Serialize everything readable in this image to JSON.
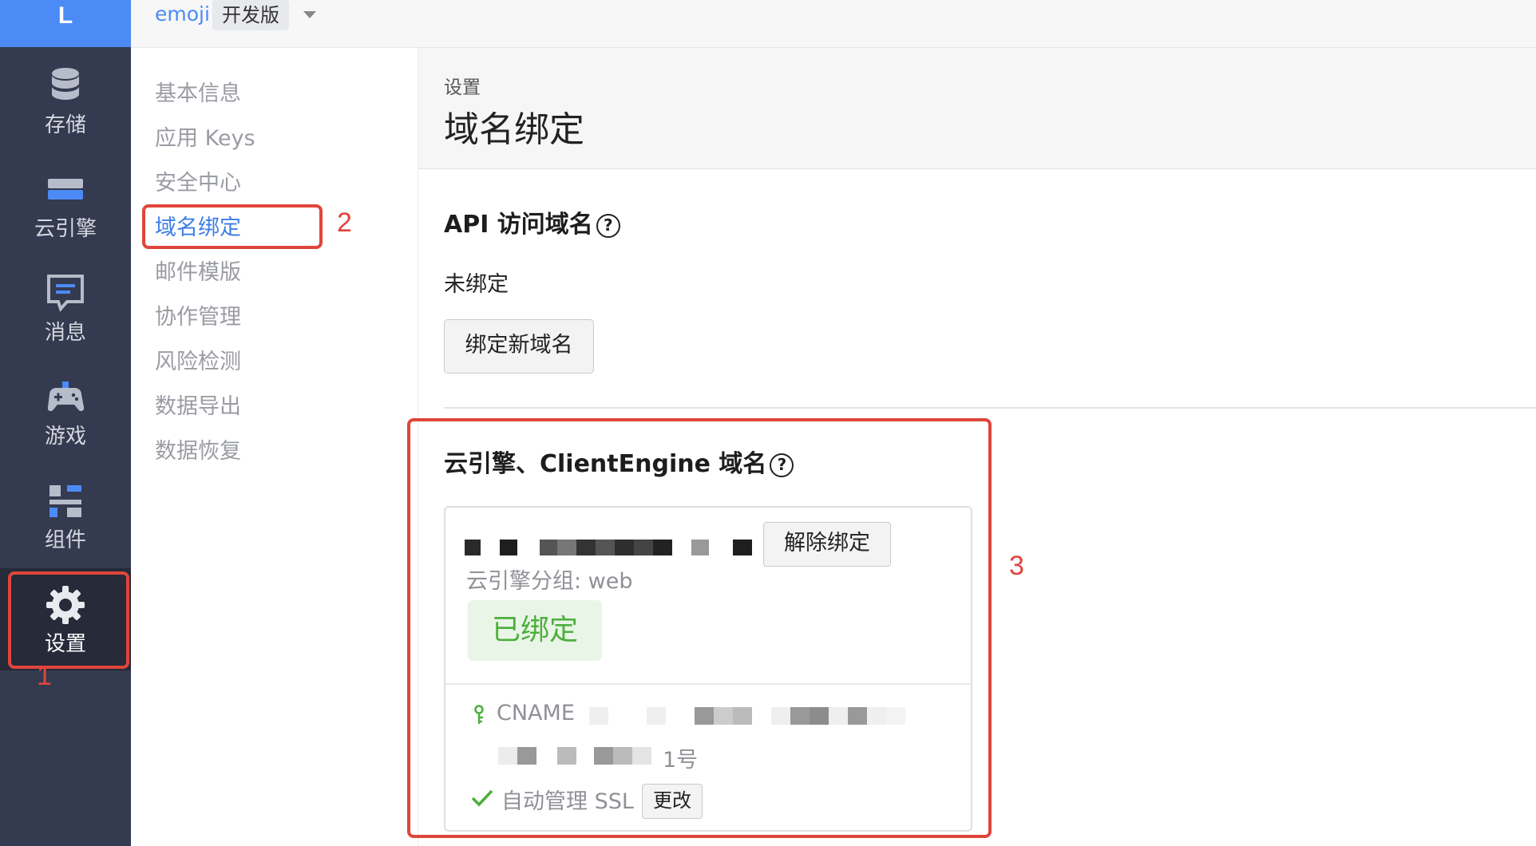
{
  "rail": {
    "logo": "L",
    "items": [
      {
        "label": "存储",
        "icon": "database-icon"
      },
      {
        "label": "云引擎",
        "icon": "server-icon"
      },
      {
        "label": "消息",
        "icon": "message-icon"
      },
      {
        "label": "游戏",
        "icon": "gamepad-icon"
      },
      {
        "label": "组件",
        "icon": "components-icon"
      },
      {
        "label": "设置",
        "icon": "gear-icon"
      }
    ]
  },
  "topbar": {
    "app_name": "emoji",
    "env": "开发版"
  },
  "subnav": {
    "items": [
      "基本信息",
      "应用 Keys",
      "安全中心",
      "域名绑定",
      "邮件模版",
      "协作管理",
      "风险检测",
      "数据导出",
      "数据恢复"
    ],
    "active": "域名绑定"
  },
  "header": {
    "breadcrumb": "设置",
    "title": "域名绑定"
  },
  "api_section": {
    "title": "API 访问域名",
    "status": "未绑定",
    "bind_button": "绑定新域名"
  },
  "engine_section": {
    "title": "云引擎、ClientEngine 域名",
    "card": {
      "unbind_button": "解除绑定",
      "group_line": "云引擎分组: web",
      "bound_badge": "已绑定",
      "cname_label": "CNAME",
      "icp_suffix": "1号",
      "ssl_text": "自动管理 SSL",
      "change_button": "更改"
    }
  },
  "annotations": [
    "1",
    "2",
    "3"
  ],
  "colors": {
    "accent": "#4c8bf5",
    "rail_bg": "#343a4f",
    "highlight": "#e0453b",
    "success": "#4caf3c"
  }
}
